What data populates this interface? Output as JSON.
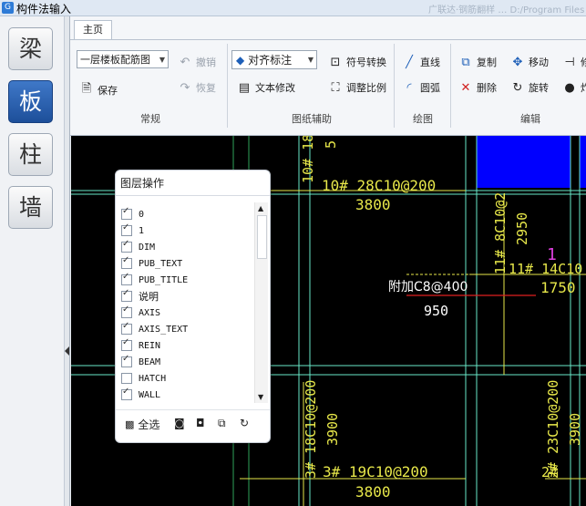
{
  "app": {
    "title": "构件法输入",
    "title_ghost": "广联达·钢筋翻样 …  D:/Program Files …"
  },
  "categories": [
    {
      "label": "梁",
      "active": false
    },
    {
      "label": "板",
      "active": true
    },
    {
      "label": "柱",
      "active": false
    },
    {
      "label": "墙",
      "active": false
    }
  ],
  "ribbon": {
    "tab": "主页",
    "groups": {
      "general": "常规",
      "drawing_aux": "图纸辅助",
      "draw": "绘图",
      "edit": "编辑"
    },
    "floor_select": "一层楼板配筋图",
    "save": "保存",
    "undo": "撤销",
    "redo": "恢复",
    "align_label": "对齐标注",
    "symbol_convert": "符号转换",
    "text_modify": "文本修改",
    "adjust_scale": "调整比例",
    "line": "直线",
    "arc": "圆弧",
    "copy": "复制",
    "move": "移动",
    "delete": "删除",
    "rotate": "旋转",
    "more1": "修",
    "more2": "炸"
  },
  "layer_panel": {
    "title": "图层操作",
    "layers": [
      {
        "name": "0",
        "checked": true
      },
      {
        "name": "1",
        "checked": true
      },
      {
        "name": "DIM",
        "checked": true
      },
      {
        "name": "PUB_TEXT",
        "checked": true
      },
      {
        "name": "PUB_TITLE",
        "checked": true
      },
      {
        "name": "说明",
        "checked": true
      },
      {
        "name": "AXIS",
        "checked": true
      },
      {
        "name": "AXIS_TEXT",
        "checked": true
      },
      {
        "name": "REIN",
        "checked": true
      },
      {
        "name": "BEAM",
        "checked": true
      },
      {
        "name": "HATCH",
        "checked": false
      },
      {
        "name": "WALL",
        "checked": true
      }
    ],
    "select_all": "全选"
  },
  "drawing": {
    "texts": {
      "t1": "10# 18",
      "t1b": "5",
      "t2": "10# 28C10@200",
      "t3": "3800",
      "t4": "11# 8C10@2",
      "t4b": "2950",
      "t5": "11# 14C10",
      "t6": "1750",
      "t7": "1",
      "t8": "附加C8@400",
      "t9": "950",
      "t10": "3# 18C10@200",
      "t11": "3900",
      "t12": "3# 19C10@200",
      "t13": "3800",
      "t14": "2# 23C10@200",
      "t15": "3900",
      "t16": "2#"
    },
    "colors": {
      "yellow": "#e8e84a",
      "cyan": "#69e8c8",
      "green": "#2fa35a",
      "blue": "#0000ff",
      "red": "#e02020",
      "magenta": "#e040e0",
      "white": "#ffffff"
    }
  }
}
